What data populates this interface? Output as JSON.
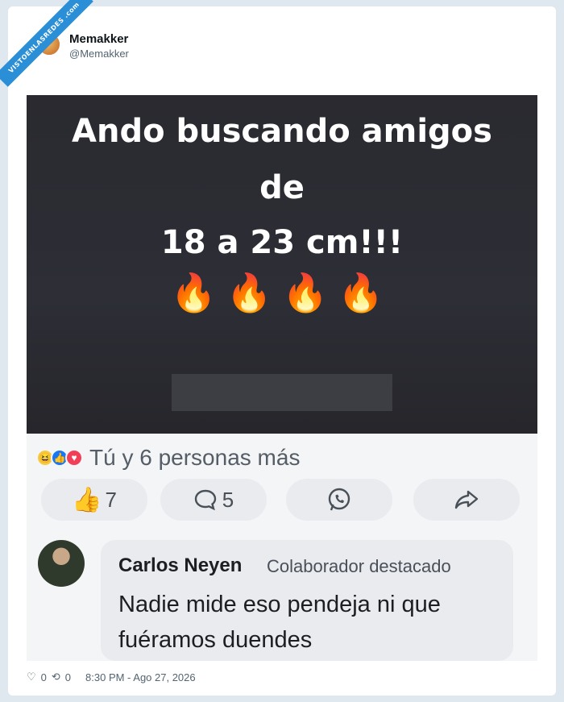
{
  "watermark": "VISTOENLASREDES .com",
  "author": {
    "name": "Memakker",
    "handle": "@Memakker"
  },
  "meme": {
    "line1": "Ando buscando amigos",
    "line2": "de",
    "line3": "18 a 23 cm!!!",
    "emojis": "🔥🔥🔥🔥"
  },
  "facebook": {
    "reactions_text": "Tú y 6 personas más",
    "like_count": "7",
    "comment_count": "5",
    "comment": {
      "author": "Carlos Neyen",
      "badge": "Colaborador destacado",
      "text": "Nadie mide eso pendeja ni que fuéramos duendes"
    }
  },
  "footer": {
    "likes": "0",
    "retweets": "0",
    "timestamp": "8:30 PM - Ago 27, 2026"
  }
}
